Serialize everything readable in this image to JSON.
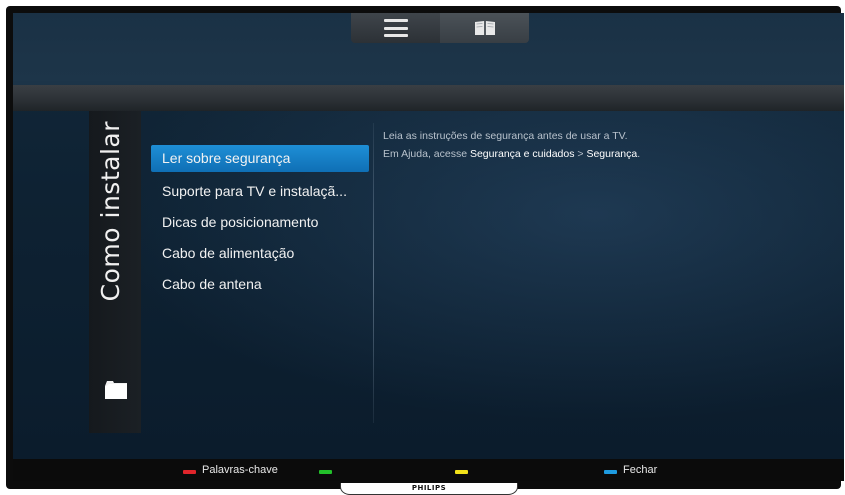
{
  "top_tabs": [
    {
      "icon": "menu-icon"
    },
    {
      "icon": "book-icon"
    }
  ],
  "side_panel": {
    "title": "Como instalar",
    "icon": "folder-icon"
  },
  "menu": {
    "items": [
      {
        "label": "Ler sobre segurança",
        "selected": true
      },
      {
        "label": "Suporte para TV e instalaçã..."
      },
      {
        "label": "Dicas de posicionamento"
      },
      {
        "label": "Cabo de alimentação"
      },
      {
        "label": "Cabo de antena"
      }
    ]
  },
  "info": {
    "line1": "Leia as instruções de segurança antes de usar a TV.",
    "line2_prefix": "Em Ajuda, acesse ",
    "link1": "Segurança e cuidados",
    "separator": " > ",
    "link2": "Segurança",
    "suffix": "."
  },
  "color_keys": [
    {
      "color": "#e0252b",
      "label": "Palavras-chave"
    },
    {
      "color": "#22c02a",
      "label": ""
    },
    {
      "color": "#f2e21a",
      "label": ""
    },
    {
      "color": "#1e9be0",
      "label": "Fechar"
    }
  ],
  "brand": "PHILIPS"
}
